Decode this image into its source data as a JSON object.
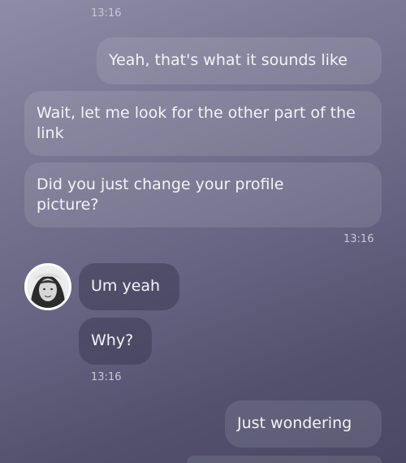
{
  "messages": [
    {
      "direction": "out",
      "text": ""
    },
    {
      "direction": "out",
      "text": "Yeah, that's what it sounds like"
    },
    {
      "direction": "out",
      "text": "Wait, let me look for the other part of the link"
    },
    {
      "direction": "out",
      "text": "Did you just change your profile picture?"
    },
    {
      "direction": "in",
      "text": "Um yeah"
    },
    {
      "direction": "in",
      "text": "Why?"
    },
    {
      "direction": "out",
      "text": "Just wondering"
    },
    {
      "direction": "out",
      "text": ""
    }
  ],
  "timestamps": {
    "first": "13:16",
    "second": "13:16",
    "third": "13:16"
  },
  "contact": {
    "avatar_icon": "profile-photo-avatar"
  },
  "colors": {
    "bubble": "#8a87a0",
    "text": "#f4f2f8",
    "timestamp": "#c9c6d6"
  }
}
